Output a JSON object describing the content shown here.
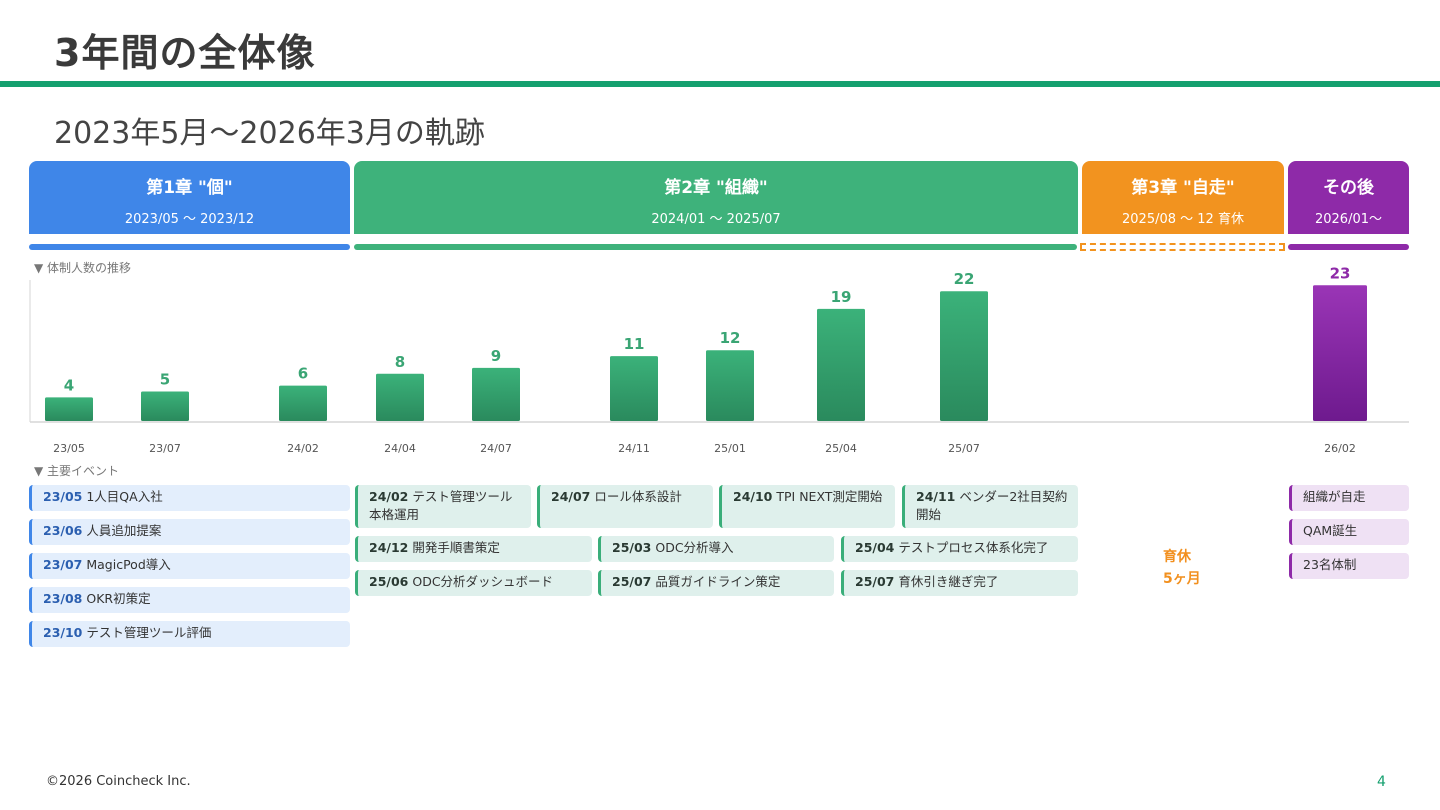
{
  "header": {
    "title": "3年間の全体像",
    "subtitle": "2023年5月〜2026年3月の軌跡"
  },
  "colors": {
    "accent": "#15a06f",
    "chapter1": "#3f86e8",
    "chapter2": "#3eb27b",
    "chapter3": "#f2931f",
    "after": "#8e2aa8"
  },
  "phases": [
    {
      "title": "第1章 \"個\"",
      "dates": "2023/05 〜 2023/12"
    },
    {
      "title": "第2章 \"組織\"",
      "dates": "2024/01 〜 2025/07"
    },
    {
      "title": "第3章 \"自走\"",
      "dates": "2025/08 〜 12 育休"
    },
    {
      "title": "その後",
      "dates": "2026/01〜"
    }
  ],
  "chart_section_label": "▼ 体制人数の推移",
  "chart_data": {
    "type": "bar",
    "categories": [
      "23/05",
      "23/07",
      "24/02",
      "24/04",
      "24/07",
      "24/11",
      "25/01",
      "25/04",
      "25/07",
      "26/02"
    ],
    "values": [
      4,
      5,
      6,
      8,
      9,
      11,
      12,
      19,
      22,
      23
    ],
    "title": "",
    "xlabel": "",
    "ylabel": "",
    "ylim": [
      0,
      25
    ],
    "grid": false
  },
  "events_section_label": "▼ 主要イベント",
  "events": {
    "chapter1": [
      {
        "date": "23/05",
        "text": "1人目QA入社"
      },
      {
        "date": "23/06",
        "text": "人員追加提案"
      },
      {
        "date": "23/07",
        "text": "MagicPod導入"
      },
      {
        "date": "23/08",
        "text": "OKR初策定"
      },
      {
        "date": "23/10",
        "text": "テスト管理ツール評価"
      }
    ],
    "chapter2": [
      {
        "date": "24/02",
        "text": "テスト管理ツール本格運用"
      },
      {
        "date": "24/07",
        "text": "ロール体系設計"
      },
      {
        "date": "24/10",
        "text": "TPI NEXT測定開始"
      },
      {
        "date": "24/11",
        "text": "ベンダー2社目契約開始"
      },
      {
        "date": "24/12",
        "text": "開発手順書策定"
      },
      {
        "date": "25/03",
        "text": "ODC分析導入"
      },
      {
        "date": "25/04",
        "text": "テストプロセス体系化完了"
      },
      {
        "date": "25/06",
        "text": "ODC分析ダッシュボード"
      },
      {
        "date": "25/07",
        "text": "品質ガイドライン策定"
      },
      {
        "date": "25/07",
        "text": "育休引き継ぎ完了"
      }
    ],
    "chapter3_note": [
      "育休",
      "5ヶ月"
    ],
    "after": [
      "組織が自走",
      "QAM誕生",
      "23名体制"
    ]
  },
  "footer": {
    "copyright": "©2026 Coincheck Inc.",
    "page": "4"
  }
}
